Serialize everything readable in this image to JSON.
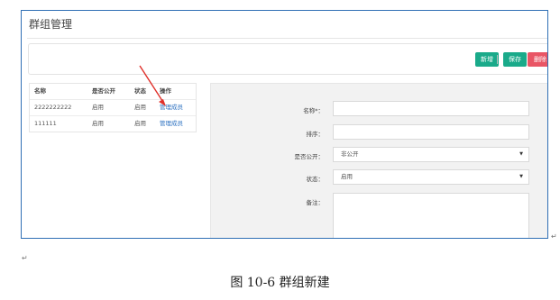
{
  "page": {
    "title": "群组管理",
    "caption": "图 10-6  群组新建",
    "pilcrow": "↵"
  },
  "toolbar": {
    "new_label": "新增",
    "save_label": "保存",
    "delete_label": "删除"
  },
  "list": {
    "headers": [
      "名称",
      "是否公开",
      "状态",
      "操作"
    ],
    "rows": [
      {
        "name": "2222222222",
        "public": "启用",
        "status": "启用",
        "action": "管理成员"
      },
      {
        "name": "111111",
        "public": "启用",
        "status": "启用",
        "action": "管理成员"
      }
    ]
  },
  "form": {
    "name_label": "名称*：",
    "name_value": "",
    "order_label": "排序：",
    "order_value": "",
    "public_label": "是否公开：",
    "public_value": "非公开",
    "status_label": "状态：",
    "status_value": "启用",
    "remark_label": "备注：",
    "remark_value": ""
  },
  "colors": {
    "accent": "#1aaa8a",
    "danger": "#e95565",
    "frame": "#2f6fb5",
    "annotation": "#e0302a"
  }
}
